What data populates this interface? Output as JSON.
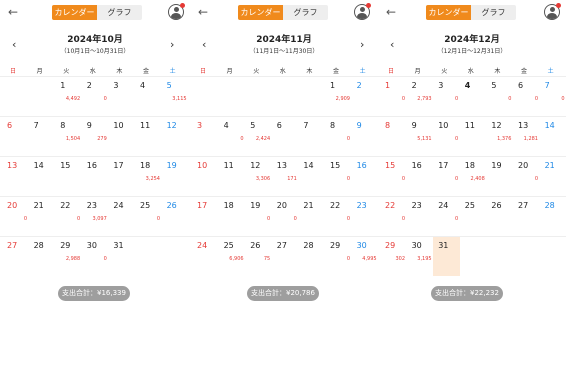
{
  "ui": {
    "calendar_label": "カレンダー",
    "graph_label": "グラフ",
    "back": "←",
    "prev": "‹",
    "next": "›"
  },
  "weekdays": [
    "日",
    "月",
    "火",
    "水",
    "木",
    "金",
    "土"
  ],
  "panels": [
    {
      "title": "2024年10月",
      "range": "（10月1日～10月31日）",
      "total": "支出合計：¥16,339",
      "show_prev": true,
      "show_next": true,
      "rows": [
        [
          {
            "d": ""
          },
          {
            "d": ""
          },
          {
            "d": "1",
            "a": "4,492"
          },
          {
            "d": "2",
            "a": "0"
          },
          {
            "d": "3"
          },
          {
            "d": "4"
          },
          {
            "d": "5",
            "a": "3,115"
          }
        ],
        [
          {
            "d": "6"
          },
          {
            "d": "7"
          },
          {
            "d": "8",
            "a": "1,504"
          },
          {
            "d": "9",
            "a": "279"
          },
          {
            "d": "10"
          },
          {
            "d": "11"
          },
          {
            "d": "12"
          }
        ],
        [
          {
            "d": "13"
          },
          {
            "d": "14"
          },
          {
            "d": "15"
          },
          {
            "d": "16"
          },
          {
            "d": "17"
          },
          {
            "d": "18",
            "a": "3,254"
          },
          {
            "d": "19"
          }
        ],
        [
          {
            "d": "20",
            "a": "0"
          },
          {
            "d": "21"
          },
          {
            "d": "22",
            "a": "0"
          },
          {
            "d": "23",
            "a": "3,097"
          },
          {
            "d": "24"
          },
          {
            "d": "25",
            "a": "0"
          },
          {
            "d": "26"
          }
        ],
        [
          {
            "d": "27"
          },
          {
            "d": "28"
          },
          {
            "d": "29",
            "a": "2,988"
          },
          {
            "d": "30",
            "a": "0"
          },
          {
            "d": "31"
          },
          {
            "d": ""
          },
          {
            "d": ""
          }
        ]
      ]
    },
    {
      "title": "2024年11月",
      "range": "（11月1日～11月30日）",
      "total": "支出合計：¥20,786",
      "show_prev": true,
      "show_next": true,
      "rows": [
        [
          {
            "d": ""
          },
          {
            "d": ""
          },
          {
            "d": ""
          },
          {
            "d": ""
          },
          {
            "d": ""
          },
          {
            "d": "1",
            "a": "2,909"
          },
          {
            "d": "2"
          }
        ],
        [
          {
            "d": "3"
          },
          {
            "d": "4",
            "a": "0"
          },
          {
            "d": "5",
            "a": "2,424"
          },
          {
            "d": "6"
          },
          {
            "d": "7"
          },
          {
            "d": "8",
            "a": "0"
          },
          {
            "d": "9"
          }
        ],
        [
          {
            "d": "10"
          },
          {
            "d": "11"
          },
          {
            "d": "12",
            "a": "3,306"
          },
          {
            "d": "13",
            "a": "171"
          },
          {
            "d": "14"
          },
          {
            "d": "15",
            "a": "0"
          },
          {
            "d": "16"
          }
        ],
        [
          {
            "d": "17"
          },
          {
            "d": "18"
          },
          {
            "d": "19",
            "a": "0"
          },
          {
            "d": "20",
            "a": "0"
          },
          {
            "d": "21"
          },
          {
            "d": "22",
            "a": "0"
          },
          {
            "d": "23"
          }
        ],
        [
          {
            "d": "24"
          },
          {
            "d": "25",
            "a": "6,906"
          },
          {
            "d": "26",
            "a": "75"
          },
          {
            "d": "27"
          },
          {
            "d": "28"
          },
          {
            "d": "29",
            "a": "0"
          },
          {
            "d": "30",
            "a": "4,995"
          }
        ]
      ]
    },
    {
      "title": "2024年12月",
      "range": "（12月1日～12月31日）",
      "total": "支出合計：¥22,232",
      "show_prev": true,
      "show_next": false,
      "rows": [
        [
          {
            "d": "1",
            "a": "0"
          },
          {
            "d": "2",
            "a": "2,793"
          },
          {
            "d": "3",
            "a": "0"
          },
          {
            "d": "4",
            "b": true
          },
          {
            "d": "5",
            "a": "0"
          },
          {
            "d": "6",
            "a": "0"
          },
          {
            "d": "7",
            "a": "0"
          }
        ],
        [
          {
            "d": "8"
          },
          {
            "d": "9",
            "a": "5,131"
          },
          {
            "d": "10",
            "a": "0"
          },
          {
            "d": "11"
          },
          {
            "d": "12",
            "a": "1,376"
          },
          {
            "d": "13",
            "a": "1,281"
          },
          {
            "d": "14"
          }
        ],
        [
          {
            "d": "15",
            "a": "0"
          },
          {
            "d": "16"
          },
          {
            "d": "17",
            "a": "0"
          },
          {
            "d": "18",
            "a": "2,408"
          },
          {
            "d": "19"
          },
          {
            "d": "20",
            "a": "0"
          },
          {
            "d": "21"
          }
        ],
        [
          {
            "d": "22",
            "a": "0"
          },
          {
            "d": "23"
          },
          {
            "d": "24",
            "a": "0"
          },
          {
            "d": "25"
          },
          {
            "d": "26"
          },
          {
            "d": "27"
          },
          {
            "d": "28"
          }
        ],
        [
          {
            "d": "29",
            "a": "302"
          },
          {
            "d": "30",
            "a": "3,195"
          },
          {
            "d": "31",
            "today": true
          },
          {
            "d": ""
          },
          {
            "d": ""
          },
          {
            "d": ""
          },
          {
            "d": ""
          }
        ]
      ]
    }
  ]
}
